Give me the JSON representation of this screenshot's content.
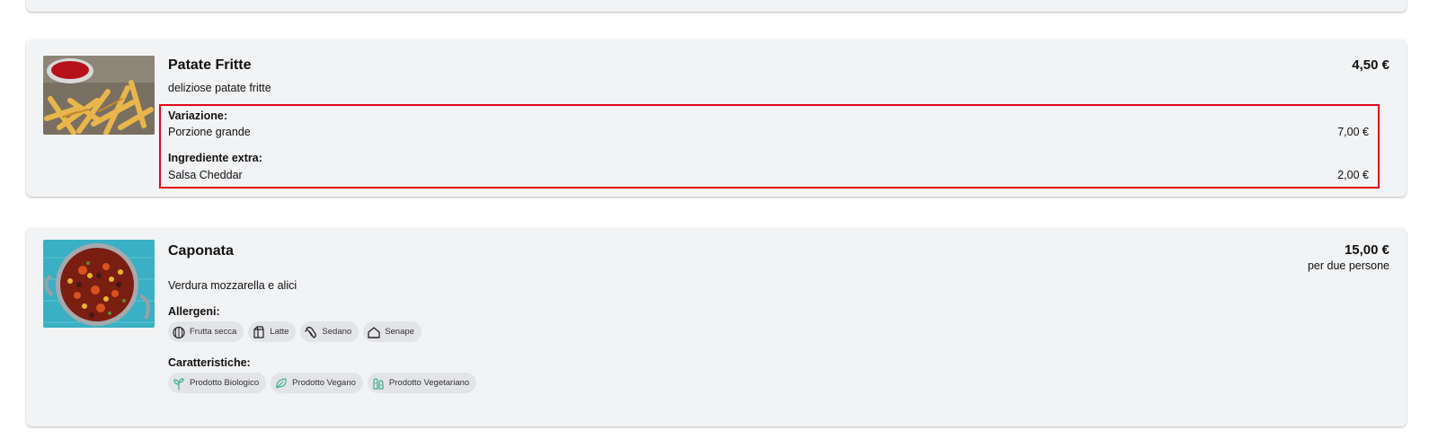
{
  "items": [
    {
      "name": "Patate Fritte",
      "description": "deliziose patate fritte",
      "price": "4,50 €",
      "options": [
        {
          "heading": "Variazione:",
          "choice": "Porzione grande",
          "price": "7,00 €"
        },
        {
          "heading": "Ingrediente extra:",
          "choice": "Salsa Cheddar",
          "price": "2,00 €"
        }
      ]
    },
    {
      "name": "Caponata",
      "description": "Verdura mozzarella e alici",
      "price": "15,00 €",
      "price_note": "per due persone",
      "allergens_label": "Allergeni:",
      "allergens": [
        {
          "label": "Frutta secca",
          "icon": "nut-icon"
        },
        {
          "label": "Latte",
          "icon": "milk-icon"
        },
        {
          "label": "Sedano",
          "icon": "celery-icon"
        },
        {
          "label": "Senape",
          "icon": "mustard-icon"
        }
      ],
      "features_label": "Caratteristiche:",
      "features": [
        {
          "label": "Prodotto Biologico",
          "icon": "organic-icon"
        },
        {
          "label": "Prodotto Vegano",
          "icon": "vegan-leaf-icon"
        },
        {
          "label": "Prodotto Vegetariano",
          "icon": "vegetarian-icon"
        }
      ]
    }
  ],
  "colors": {
    "card_background": "#f2f3f5",
    "highlight_border": "#e3061c",
    "chip_background": "#e3e4e7",
    "feature_icon": "#3fb08a"
  }
}
